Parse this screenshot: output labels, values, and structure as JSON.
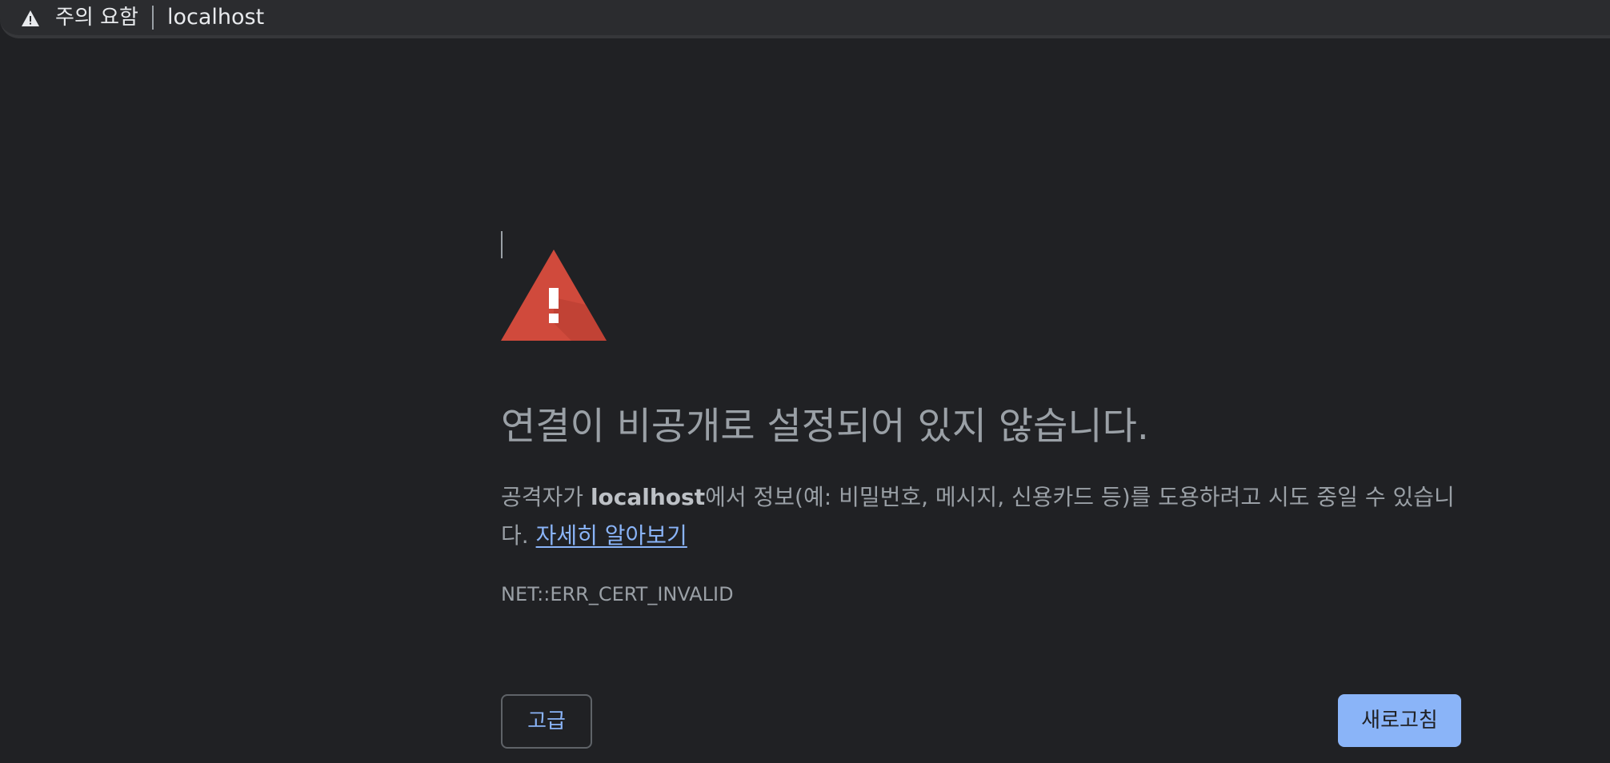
{
  "omnibox": {
    "security_icon": "warning-triangle-icon",
    "security_label": "주의 요함",
    "url": "localhost"
  },
  "interstitial": {
    "icon": "red-warning-triangle-icon",
    "title": "연결이 비공개로 설정되어 있지 않습니다.",
    "body_prefix": "공격자가 ",
    "body_host": "localhost",
    "body_suffix": "에서 정보(예: 비밀번호, 메시지, 신용카드 등)를 도용하려고 시도 중일 수 있습니다. ",
    "learn_more": "자세히 알아보기",
    "error_code": "NET::ERR_CERT_INVALID",
    "advanced_label": "고급",
    "reload_label": "새로고침"
  },
  "colors": {
    "background": "#202124",
    "warning_red": "#d04a3c",
    "link_blue": "#8ab4f8",
    "text_grey": "#9aa0a6"
  }
}
